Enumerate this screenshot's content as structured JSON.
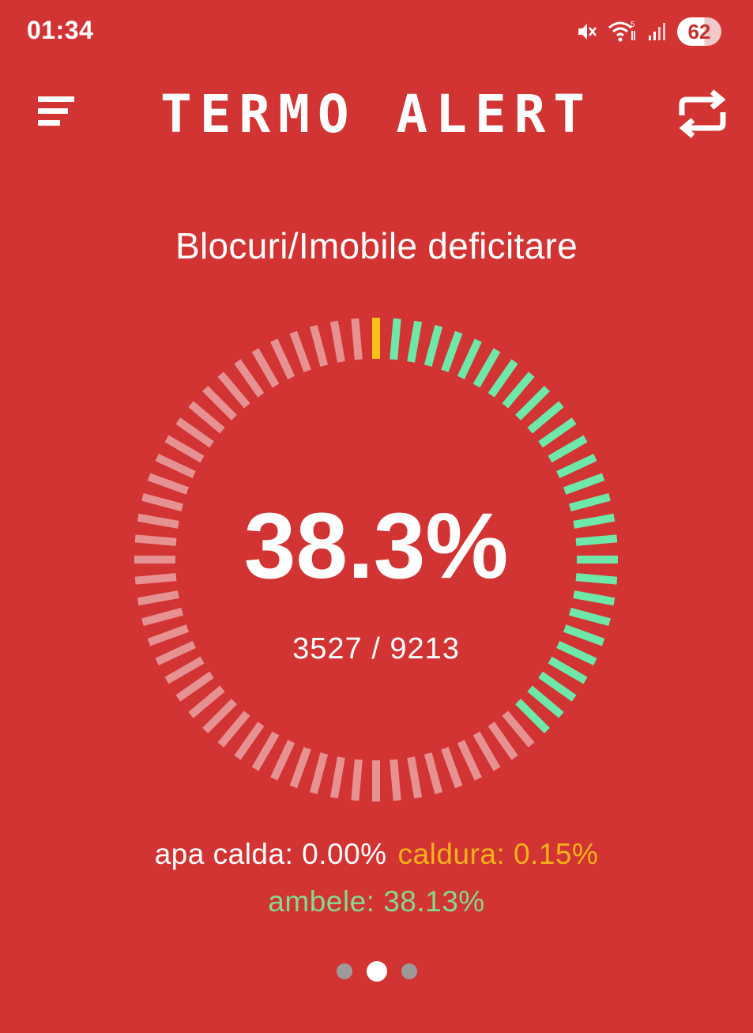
{
  "status_bar": {
    "time": "01:34",
    "battery": "62",
    "icons": [
      "mute-icon",
      "wifi-icon",
      "signal-icon",
      "battery-icon"
    ]
  },
  "app_bar": {
    "title": "TERMO ALERT",
    "menu_icon": "menu-icon",
    "refresh_icon": "refresh-icon"
  },
  "section": {
    "title": "Blocuri/Imobile deficitare"
  },
  "gauge": {
    "percent_label": "38.3%",
    "percent_value": 38.3,
    "count_label": "3527 / 9213",
    "segments": 72,
    "start_angle_deg": 0,
    "active_color": "#6ee8a8",
    "marker_color": "#f6c21a",
    "inactive_color": "#eaa3a3"
  },
  "stats": {
    "hot_water": "apa calda: 0.00%",
    "heating": "caldura: 0.15%",
    "both": "ambele: 38.13%"
  },
  "pager": {
    "count": 3,
    "active_index": 1
  },
  "colors": {
    "background": "#d23333",
    "hot_water": "#ffffff",
    "heating": "#f6b21a",
    "both": "#86d98a"
  }
}
